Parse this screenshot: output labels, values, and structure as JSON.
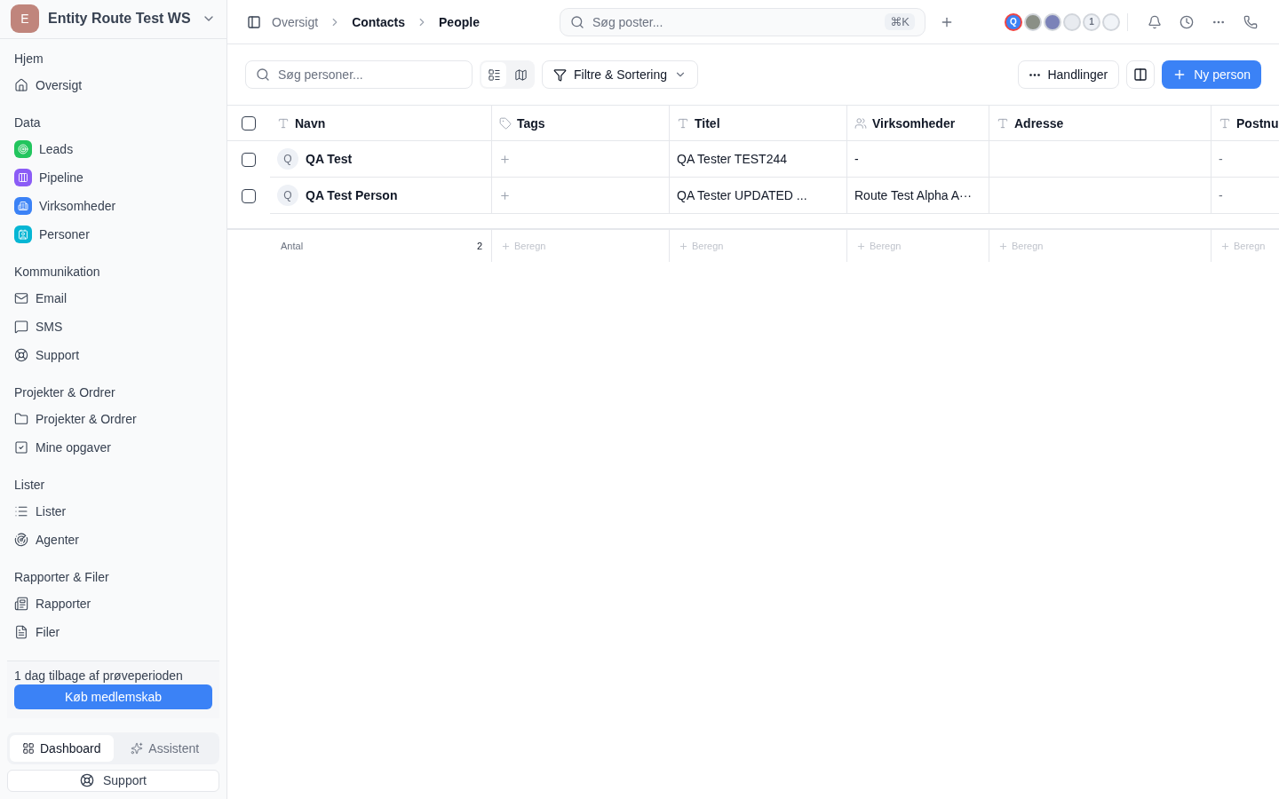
{
  "workspace": {
    "initial": "E",
    "name": "Entity Route Test WS"
  },
  "sidebar": {
    "sections": [
      {
        "title": "Hjem",
        "items": [
          {
            "label": "Oversigt"
          }
        ]
      },
      {
        "title": "Data",
        "items": [
          {
            "label": "Leads",
            "color": "#22c55e"
          },
          {
            "label": "Pipeline",
            "color": "#8b5cf6"
          },
          {
            "label": "Virksomheder",
            "color": "#3b82f6"
          },
          {
            "label": "Personer",
            "color": "#06b6d4"
          }
        ]
      },
      {
        "title": "Kommunikation",
        "items": [
          {
            "label": "Email"
          },
          {
            "label": "SMS"
          },
          {
            "label": "Support"
          }
        ]
      },
      {
        "title": "Projekter & Ordrer",
        "items": [
          {
            "label": "Projekter & Ordrer"
          },
          {
            "label": "Mine opgaver"
          }
        ]
      },
      {
        "title": "Lister",
        "items": [
          {
            "label": "Lister"
          },
          {
            "label": "Agenter"
          }
        ]
      },
      {
        "title": "Rapporter & Filer",
        "items": [
          {
            "label": "Rapporter"
          },
          {
            "label": "Filer"
          }
        ]
      }
    ],
    "trial": {
      "text": "1 dag tilbage af prøveperioden",
      "button": "Køb medlemskab"
    },
    "mode_tabs": [
      {
        "label": "Dashboard",
        "selected": true
      },
      {
        "label": "Assistent",
        "selected": false
      }
    ],
    "support": "Support"
  },
  "breadcrumb": [
    {
      "label": "Oversigt",
      "kind": "link"
    },
    {
      "label": "Contacts",
      "kind": "strong"
    },
    {
      "label": "People",
      "kind": "current"
    }
  ],
  "global_search": {
    "placeholder": "Søg poster...",
    "shortcut": "⌘K"
  },
  "avatars": [
    {
      "text": "Q",
      "color": "#3b82f6",
      "current": true
    },
    {
      "color": "#8a8f86",
      "current": false
    },
    {
      "color": "#7b82b8",
      "current": false
    },
    {
      "color": "#e8ebf0",
      "current": false
    },
    {
      "text": "1",
      "color": "#eef1f6",
      "current": false
    },
    {
      "color": "#f1f4f8",
      "current": false
    }
  ],
  "toolbar": {
    "search_placeholder": "Søg personer...",
    "views": [
      {
        "selected": true
      },
      {
        "selected": false
      }
    ],
    "filter": "Filtre & Sortering",
    "actions": "Handlinger",
    "new": "Ny person"
  },
  "table": {
    "select_all_checked": false,
    "columns": [
      {
        "label": "Navn",
        "kind": "text"
      },
      {
        "label": "Tags",
        "kind": "tag"
      },
      {
        "label": "Titel",
        "kind": "text"
      },
      {
        "label": "Virksomheder",
        "kind": "relation"
      },
      {
        "label": "Adresse",
        "kind": "text"
      },
      {
        "label": "Postnu",
        "kind": "text"
      }
    ],
    "rows": [
      {
        "checked": false,
        "avatar": "Q",
        "name": "QA Test",
        "title": "QA Tester TEST244",
        "company": "-",
        "postal": "-"
      },
      {
        "checked": false,
        "avatar": "Q",
        "name": "QA Test Person",
        "title": "QA Tester UPDATED ...",
        "company": "Route Test Alpha A···",
        "postal": "-"
      }
    ],
    "footer": {
      "label": "Antal",
      "count": "2",
      "calc": [
        "Beregn",
        "Beregn",
        "Beregn",
        "Beregn",
        "Beregn"
      ]
    }
  }
}
